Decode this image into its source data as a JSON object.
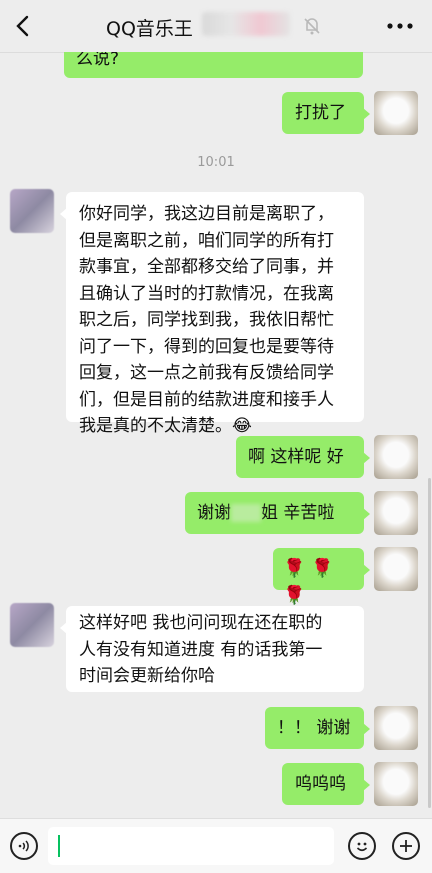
{
  "header": {
    "title": "QQ音乐王",
    "back_icon": "chevron-left-icon",
    "mute_icon": "bell-off-icon",
    "more_icon": "more-dots-icon"
  },
  "messages": [
    {
      "side": "right",
      "text": "么说?"
    },
    {
      "side": "right",
      "text": "打扰了"
    },
    {
      "time": "10:01"
    },
    {
      "side": "left",
      "lines": [
        "你好同学，我这边目前是离职了，",
        "但是离职之前，咱们同学的所有打",
        "款事宜，全部都移交给了同事，并",
        "且确认了当时的打款情况，在我离",
        "职之后，同学找到我，我依旧帮忙",
        "问了一下，得到的回复也是要等待",
        "回复，这一点之前我有反馈给同学",
        "们，但是目前的结款进度和接手人",
        "我是真的不太清楚。"
      ],
      "emoji": "😂"
    },
    {
      "side": "right",
      "text": "啊 这样呢 好"
    },
    {
      "side": "right",
      "text_a": "谢谢",
      "text_b": "姐 辛苦啦"
    },
    {
      "side": "right",
      "roses": "🌹🌹🌹"
    },
    {
      "side": "left",
      "lines": [
        "这样好吧  我也问问现在还在职的",
        "人有没有知道进度 有的话我第一",
        "时间会更新给你哈"
      ]
    },
    {
      "side": "right",
      "text": "！！ 谢谢"
    },
    {
      "side": "right",
      "text": "呜呜呜"
    }
  ],
  "input": {
    "value": ""
  },
  "toolbar": {
    "voice_icon": "voice-icon",
    "emoji_icon": "emoji-icon",
    "add_icon": "plus-icon"
  },
  "colors": {
    "sent": "#95ec69",
    "received": "#ffffff",
    "background": "#ededed"
  }
}
